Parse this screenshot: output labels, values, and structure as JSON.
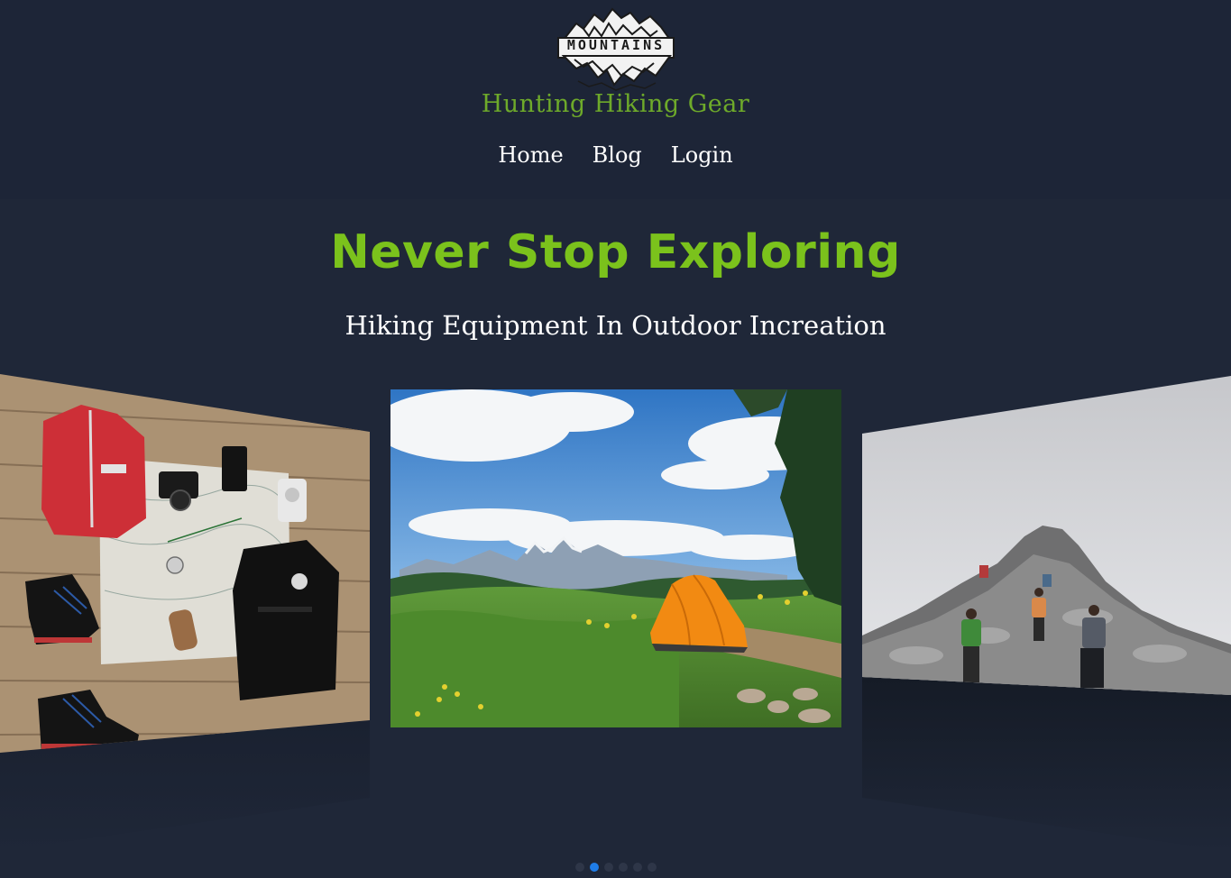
{
  "header": {
    "logo_text": "MOUNTAINS",
    "site_name": "Hunting Hiking Gear",
    "nav": [
      {
        "label": "Home"
      },
      {
        "label": "Blog"
      },
      {
        "label": "Login"
      }
    ]
  },
  "hero": {
    "title": "Never Stop Exploring",
    "subtitle": "Hiking Equipment In Outdoor Increation"
  },
  "carousel": {
    "slides": [
      {
        "name": "hiking-gear-flatlay-image"
      },
      {
        "name": "camping-tent-mountain-image"
      },
      {
        "name": "hikers-climbing-peak-image"
      }
    ],
    "dot_count": 6,
    "active_dot": 1
  },
  "colors": {
    "background": "#1e2636",
    "accent_green": "#7bc21c",
    "site_name_green": "#6eaa2a",
    "active_dot": "#1f7de8"
  }
}
